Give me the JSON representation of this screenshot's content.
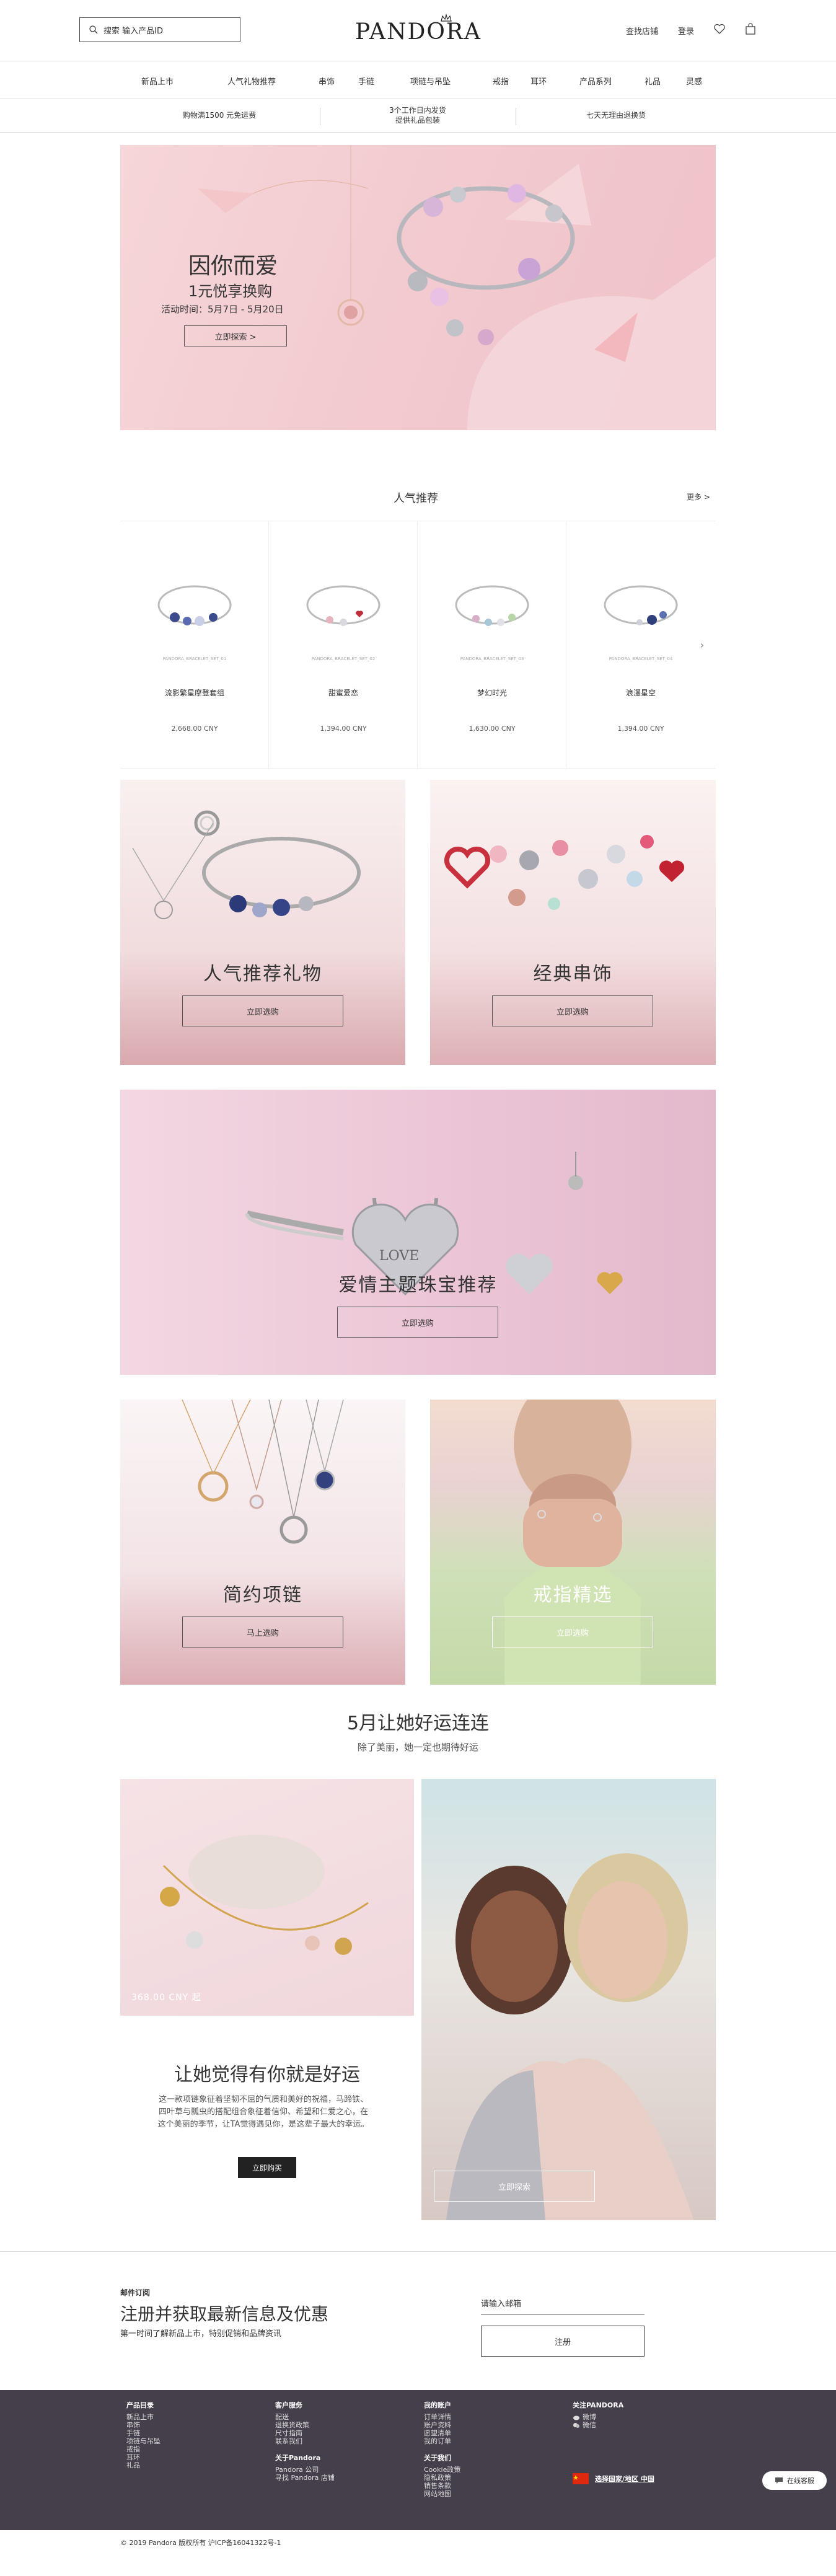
{
  "header": {
    "search_placeholder": "搜索 输入产品ID",
    "logo": "PANDORA",
    "store_link": "查找店铺",
    "login_link": "登录"
  },
  "nav": {
    "items": [
      "新品上市",
      "人气礼物推荐",
      "串饰",
      "手链",
      "项链与吊坠",
      "戒指",
      "耳环",
      "产品系列",
      "礼品",
      "灵感"
    ]
  },
  "info_strip": {
    "items": [
      {
        "line1": "购物满1500 元免运费",
        "line2": ""
      },
      {
        "line1": "3个工作日内发货",
        "line2": "提供礼品包装"
      },
      {
        "line1": "七天无理由退换货",
        "line2": ""
      }
    ]
  },
  "hero": {
    "title": "因你而爱",
    "subtitle": "1元悦享换购",
    "date": "活动时间：5月7日 - 5月20日",
    "button": "立即探索 >"
  },
  "recommended": {
    "title": "人气推荐",
    "more": "更多 >",
    "products": [
      {
        "code": "PANDORA_BRACELET_SET_01",
        "name": "流影繁星摩登套组",
        "price": "2,668.00 CNY"
      },
      {
        "code": "PANDORA_BRACELET_SET_02",
        "name": "甜蜜爱恋",
        "price": "1,394.00 CNY"
      },
      {
        "code": "PANDORA_BRACELET_SET_03",
        "name": "梦幻时光",
        "price": "1,630.00 CNY"
      },
      {
        "code": "PANDORA_BRACELET_SET_04",
        "name": "浪漫星空",
        "price": "1,394.00 CNY"
      }
    ]
  },
  "tiles": {
    "gifts": {
      "title": "人气推荐礼物",
      "button": "立即选购"
    },
    "charms": {
      "title": "经典串饰",
      "button": "立即选购"
    },
    "love": {
      "title": "爱情主题珠宝推荐",
      "button": "立即选购",
      "charm_text": "LOVE"
    },
    "necklaces": {
      "title": "简约项链",
      "button": "马上选购"
    },
    "rings": {
      "title": "戒指精选",
      "button": "立即选购"
    }
  },
  "promo": {
    "title": "5月让她好运连连",
    "subtitle": "除了美丽，她一定也期待好运",
    "price_tag": "368.00 CNY 起",
    "headline": "让她觉得有你就是好运",
    "text": "这一款项链象征着坚韧不屈的气质和美好的祝福，马蹄铁、四叶草与瓢虫的搭配组合象征着信仰、希望和仁爱之心，在这个美丽的季节，让TA觉得遇见你，是这辈子最大的幸运。",
    "button": "立即购买",
    "right_button": "立即探索"
  },
  "subscribe": {
    "label": "邮件订阅",
    "title": "注册并获取最新信息及优惠",
    "desc": "第一时间了解新品上市，特别促销和品牌资讯",
    "input_placeholder": "请输入邮箱",
    "button": "注册"
  },
  "footer": {
    "col1": {
      "heading": "产品目录",
      "items": [
        "新品上市",
        "串饰",
        "手链",
        "项链与吊坠",
        "戒指",
        "耳环",
        "礼品"
      ]
    },
    "col2": {
      "heading": "客户服务",
      "items": [
        "配送",
        "退换货政策",
        "尺寸指南",
        "联系我们"
      ],
      "heading2": "关于Pandora",
      "items2": [
        "Pandora 公司",
        "寻找 Pandora 店铺"
      ]
    },
    "col3": {
      "heading": "我的账户",
      "items": [
        "订单详情",
        "账户资料",
        "愿望清单",
        "我的订单"
      ],
      "heading2": "关于我们",
      "items2": [
        "Cookie政策",
        "隐私政策",
        "销售条款",
        "网站地图"
      ]
    },
    "col4": {
      "heading": "关注PANDORA",
      "items": [
        "微博",
        "微信"
      ]
    },
    "region": "选择国家/地区 中国",
    "chat": "在线客服"
  },
  "copyright": "© 2019 Pandora 版权所有 沪ICP备16041322号-1",
  "colors": {
    "accent_pink": "#f2cbd0",
    "footer_bg": "#453f4b",
    "brand_dark": "#222222"
  }
}
